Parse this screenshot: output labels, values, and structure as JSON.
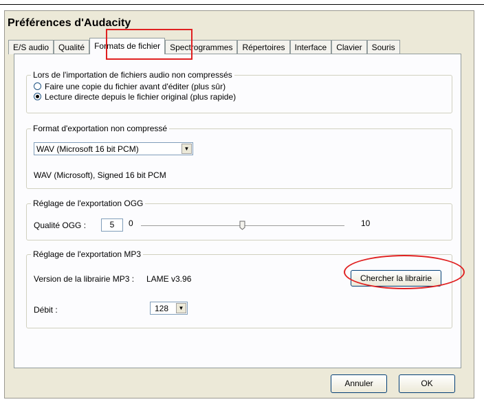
{
  "window": {
    "title": "Préférences d'Audacity"
  },
  "tabs": [
    {
      "label": "E/S audio"
    },
    {
      "label": "Qualité"
    },
    {
      "label": "Formats de fichier"
    },
    {
      "label": "Spectrogrammes"
    },
    {
      "label": "Répertoires"
    },
    {
      "label": "Interface"
    },
    {
      "label": "Clavier"
    },
    {
      "label": "Souris"
    }
  ],
  "active_tab": "Formats de fichier",
  "import_group": {
    "label": "Lors de l'importation de fichiers audio non compressés",
    "options": [
      {
        "label": "Faire une copie du fichier avant d'éditer (plus sûr)",
        "selected": false
      },
      {
        "label": "Lecture directe depuis le fichier original (plus rapide)",
        "selected": true
      }
    ]
  },
  "export_group": {
    "label": "Format d'exportation non compressé",
    "format_select": "WAV (Microsoft 16 bit PCM)",
    "format_description": "WAV (Microsoft), Signed 16 bit PCM"
  },
  "ogg_group": {
    "label": "Réglage de l'exportation OGG",
    "quality_label": "Qualité OGG :",
    "quality_value": "5",
    "slider_min": "0",
    "slider_max": "10",
    "slider_fraction": 0.5
  },
  "mp3_group": {
    "label": "Réglage de l'exportation MP3",
    "version_label": "Version de la librairie MP3 :",
    "version_value": "LAME v3.96",
    "find_library_button": "Chercher la librairie",
    "bitrate_label": "Débit :",
    "bitrate_value": "128"
  },
  "footer": {
    "cancel_button": "Annuler",
    "ok_button": "OK"
  },
  "colors": {
    "dialog_bg": "#ece9d8",
    "panel_bg": "#fcfcfe",
    "annotation_red": "#e02020"
  },
  "icons": [
    "dropdown-arrow-icon",
    "radio-icon",
    "slider-thumb-icon"
  ]
}
